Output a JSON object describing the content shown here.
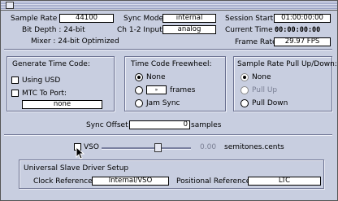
{
  "top": {
    "sample_rate_label": "Sample Rate :",
    "sample_rate_value": "44100",
    "bit_depth": "Bit Depth : 24-bit",
    "mixer": "Mixer : 24-bit Optimized",
    "sync_mode_label": "Sync Mode :",
    "sync_mode_value": "internal",
    "ch_input_label": "Ch 1-2 Input :",
    "ch_input_value": "analog",
    "session_start_label": "Session Start :",
    "session_start_value": "01:00:00:00",
    "current_time_label": "Current Time :",
    "current_time_value": "00:00:00:00",
    "frame_rate_label": "Frame Rate :",
    "frame_rate_value": "29.97 FPS"
  },
  "timecode": {
    "title": "Generate Time Code:",
    "using_usd": "Using USD",
    "mtc_to_port": "MTC To Port:",
    "port_value": "none"
  },
  "freewheel": {
    "title": "Time Code Freewheel:",
    "none": "None",
    "frames_value": "",
    "frames_label": "frames",
    "jam_sync": "Jam Sync"
  },
  "pullupdown": {
    "title": "Sample Rate Pull Up/Down:",
    "none": "None",
    "pull_up": "Pull Up",
    "pull_down": "Pull Down"
  },
  "sync_offset": {
    "label": "Sync Offset :",
    "value": "0",
    "unit": "samples"
  },
  "vso": {
    "label": "VSO",
    "value": "0.00",
    "unit": "semitones.cents"
  },
  "usd": {
    "title": "Universal Slave Driver Setup",
    "clock_ref_label": "Clock Reference :",
    "clock_ref_value": "Internal/VSO",
    "pos_ref_label": "Positional Reference :",
    "pos_ref_value": "LTC"
  }
}
